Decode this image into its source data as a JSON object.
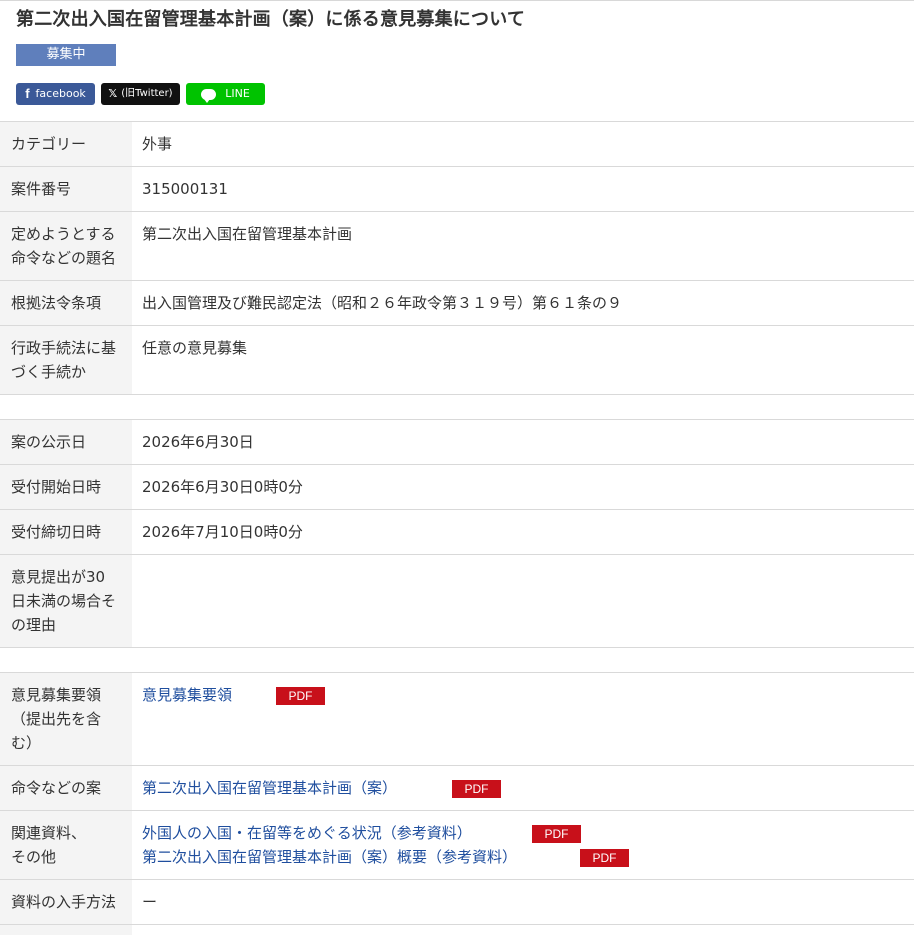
{
  "title": "第二次出入国在留管理基本計画（案）に係る意見募集について",
  "status_badge": "募集中",
  "share": {
    "facebook": "facebook",
    "x_label": "(旧Twitter)",
    "x_icon": "𝕏",
    "line": "LINE",
    "fb_icon": "f"
  },
  "rows": {
    "category": {
      "label": "カテゴリー",
      "value": "外事"
    },
    "case_number": {
      "label": "案件番号",
      "value": "315000131"
    },
    "order_title": {
      "label_line1": "定めようとする",
      "label_line2": "命令などの題名",
      "value": "第二次出入国在留管理基本計画"
    },
    "legal_basis": {
      "label": "根拠法令条項",
      "value": "出入国管理及び難民認定法（昭和２６年政令第３１９号）第６１条の９"
    },
    "procedure": {
      "label_line1": "行政手続法に基",
      "label_line2": "づく手続か",
      "value": "任意の意見募集"
    },
    "publication_date": {
      "label": "案の公示日",
      "value": "2026年6月30日"
    },
    "start_date": {
      "label": "受付開始日時",
      "value": "2026年6月30日0時0分"
    },
    "end_date": {
      "label": "受付締切日時",
      "value": "2026年7月10日0時0分"
    },
    "short_reason": {
      "label_line1": "意見提出が30",
      "label_line2": "日未満の場合そ",
      "label_line3": "の理由",
      "value": ""
    },
    "guidelines": {
      "label_line1": "意見募集要領",
      "label_line2": "（提出先を含",
      "label_line3": "む）",
      "link": "意見募集要領",
      "pdf": "PDF"
    },
    "draft": {
      "label": "命令などの案",
      "link": "第二次出入国在留管理基本計画（案）",
      "pdf": "PDF"
    },
    "related": {
      "label_line1": "関連資料、",
      "label_line2": "その他",
      "link1": "外国人の入国・在留等をめぐる状況（参考資料）",
      "pdf1": "PDF",
      "link2": "第二次出入国在留管理基本計画（案）概要（参考資料）",
      "pdf2": "PDF"
    },
    "acquisition": {
      "label": "資料の入手方法",
      "value": "ー"
    }
  }
}
